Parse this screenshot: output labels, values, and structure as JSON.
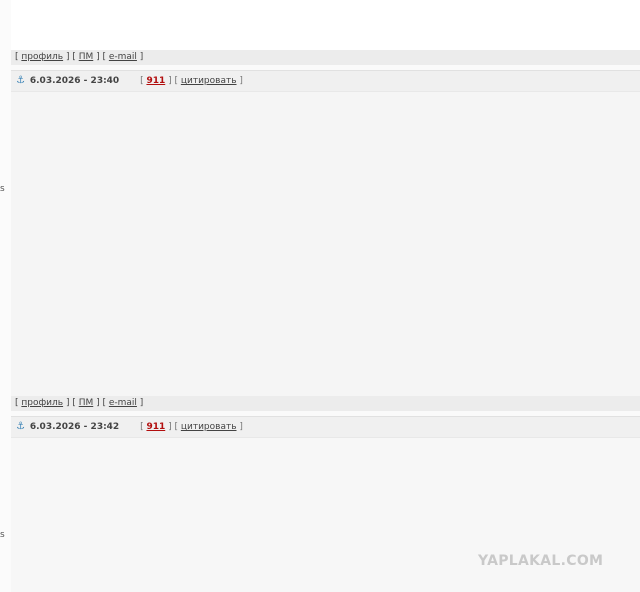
{
  "footer_links_1": {
    "open1": "[ ",
    "profile": "профиль",
    "sep1": " ] [ ",
    "pm": "ПМ",
    "sep2": " ] [ ",
    "email": "e-mail",
    "close": " ]"
  },
  "post1": {
    "date": "6.03.2026 - 23:40",
    "rating_open": "[ ",
    "rating": "911",
    "rating_sep": " ] [ ",
    "quote": "цитировать",
    "quote_close": " ]"
  },
  "footer_links_2": {
    "open1": "[ ",
    "profile": "профиль",
    "sep1": " ] [ ",
    "pm": "ПМ",
    "sep2": " ] [ ",
    "email": "e-mail",
    "close": " ]"
  },
  "post2": {
    "date": "6.03.2026 - 23:42",
    "rating_open": "[ ",
    "rating": "911",
    "rating_sep": " ] [ ",
    "quote": "цитировать",
    "quote_close": " ]"
  },
  "side_mark": "s",
  "logo": "YAPLAKAL.COM",
  "colors": {
    "rating": "#b20e0e",
    "anchor": "#3f86b8",
    "bar": "#ececec"
  }
}
